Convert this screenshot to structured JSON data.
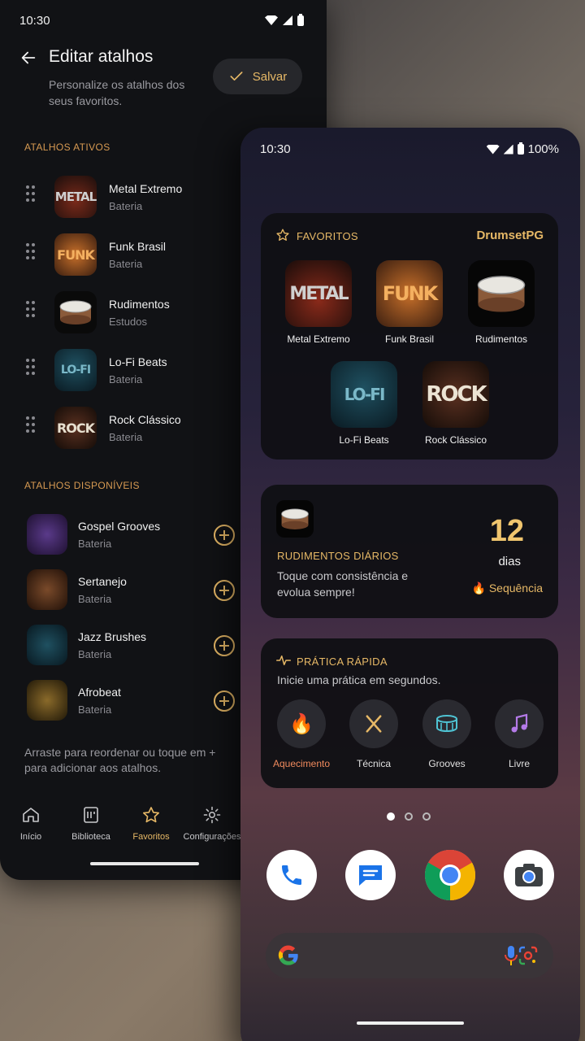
{
  "left_screen": {
    "status_time": "10:30",
    "title": "Editar atalhos",
    "subtitle": "Personalize os atalhos dos seus favoritos.",
    "save_label": "Salvar",
    "active_section": "ATALHOS ATIVOS",
    "active": [
      {
        "title": "Metal Extremo",
        "sub": "Bateria",
        "art": "METAL"
      },
      {
        "title": "Funk Brasil",
        "sub": "Bateria",
        "art": "FUNK"
      },
      {
        "title": "Rudimentos",
        "sub": "Estudos",
        "art": ""
      },
      {
        "title": "Lo-Fi Beats",
        "sub": "Bateria",
        "art": "LO-FI"
      },
      {
        "title": "Rock Clássico",
        "sub": "Bateria",
        "art": "ROCK"
      }
    ],
    "available_section": "ATALHOS DISPONÍVEIS",
    "available": [
      {
        "title": "Gospel Grooves",
        "sub": "Bateria"
      },
      {
        "title": "Sertanejo",
        "sub": "Bateria"
      },
      {
        "title": "Jazz Brushes",
        "sub": "Bateria"
      },
      {
        "title": "Afrobeat",
        "sub": "Bateria"
      }
    ],
    "hint": "Arraste para reordenar ou toque em + para adicionar aos atalhos.",
    "nav": [
      {
        "label": "Início",
        "icon": "home-icon"
      },
      {
        "label": "Biblioteca",
        "icon": "library-icon"
      },
      {
        "label": "Favoritos",
        "icon": "star-icon"
      },
      {
        "label": "Configurações",
        "icon": "gear-icon"
      }
    ]
  },
  "right_screen": {
    "status_time": "10:30",
    "battery": "100%",
    "favorites_widget": {
      "heading": "FAVORITOS",
      "brand": "DrumsetPG",
      "items": [
        {
          "label": "Metal Extremo",
          "art": "METAL"
        },
        {
          "label": "Funk Brasil",
          "art": "FUNK"
        },
        {
          "label": "Rudimentos",
          "art": ""
        },
        {
          "label": "Lo-Fi Beats",
          "art": "LO-FI"
        },
        {
          "label": "Rock Clássico",
          "art": "ROCK"
        }
      ]
    },
    "rudiments_widget": {
      "heading": "RUDIMENTOS DIÁRIOS",
      "text": "Toque com consistência e evolua sempre!",
      "streak_value": "12",
      "streak_unit": "dias",
      "streak_label": "🔥 Sequência"
    },
    "quick_practice_widget": {
      "heading": "PRÁTICA RÁPIDA",
      "text": "Inicie uma prática em segundos.",
      "actions": [
        {
          "label": "Aquecimento",
          "icon": "fire-icon"
        },
        {
          "label": "Técnica",
          "icon": "sticks-icon"
        },
        {
          "label": "Grooves",
          "icon": "drum-icon"
        },
        {
          "label": "Livre",
          "icon": "music-note-icon"
        }
      ]
    },
    "colors": {
      "accent": "#e6b866",
      "active_action": "#f08a5d"
    }
  }
}
